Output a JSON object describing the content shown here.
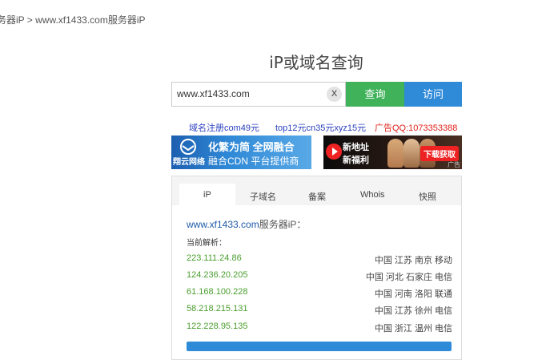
{
  "breadcrumb": "务器iP > www.xf1433.com服务器iP",
  "title": "iP或域名查询",
  "search": {
    "value": "www.xf1433.com",
    "clear_label": "X",
    "query_label": "查询",
    "visit_label": "访问"
  },
  "links": [
    {
      "text": "域名注册com49元",
      "color": "#2a3fbf"
    },
    {
      "text": "top12元cn35元xyz15元",
      "color": "#2a3fbf"
    },
    {
      "text": "广告QQ:1073353388",
      "color": "#e0231e"
    }
  ],
  "banner_left": {
    "brand": "翔云网络",
    "line1": "化繁为简 全网融合",
    "line2": "融合CDN 平台提供商"
  },
  "banner_right": {
    "line1": "新地址",
    "line2": "新福利",
    "cta": "下载获取",
    "ad_mark": "广告"
  },
  "tabs": [
    "iP",
    "子域名",
    "备案",
    "Whois",
    "快照"
  ],
  "result": {
    "domain": "www.xf1433.com",
    "suffix": "服务器iP：",
    "parse_label": "当前解析：",
    "rows": [
      {
        "ip": "223.111.24.86",
        "location": "中国 江苏 南京 移动"
      },
      {
        "ip": "124.236.20.205",
        "location": "中国 河北 石家庄 电信"
      },
      {
        "ip": "61.168.100.228",
        "location": "中国 河南 洛阳 联通"
      },
      {
        "ip": "58.218.215.131",
        "location": "中国 江苏 徐州 电信"
      },
      {
        "ip": "122.228.95.135",
        "location": "中国 浙江 温州 电信"
      }
    ]
  }
}
